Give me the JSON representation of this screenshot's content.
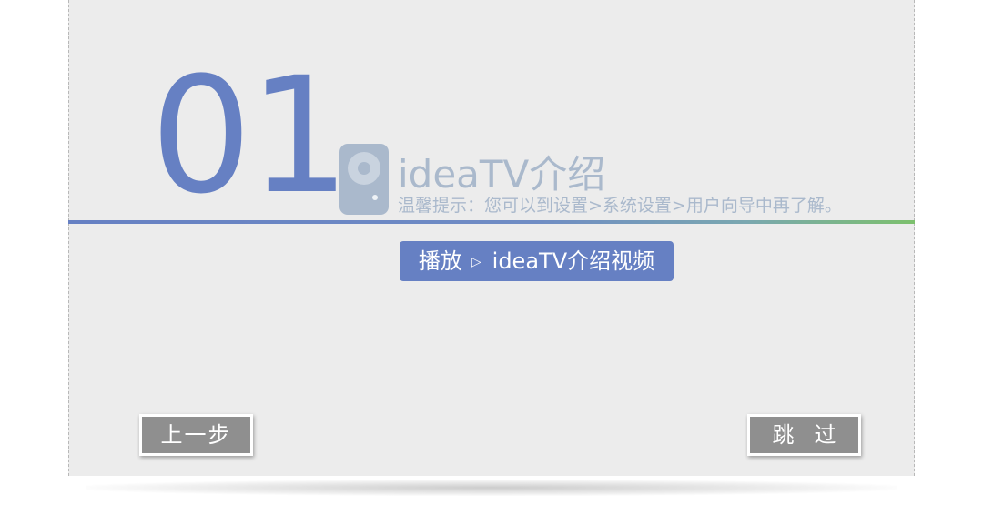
{
  "step": {
    "number": "01",
    "title": "ideaTV介绍",
    "tip": "温馨提示：您可以到设置>系统设置>用户向导中再了解。"
  },
  "play_button": {
    "label_prefix": "播放",
    "label_main": "ideaTV介绍视频"
  },
  "navigation": {
    "prev_label": "上一步",
    "skip_label": "跳过"
  },
  "icons": {
    "remote": "remote-control-icon",
    "play_arrow": "play-triangle-icon"
  },
  "colors": {
    "accent": "#6680c3",
    "muted_text": "#aab9cc",
    "background": "#ececec",
    "button_gray": "#8f8f8f",
    "divider_end": "#7cc06d"
  }
}
